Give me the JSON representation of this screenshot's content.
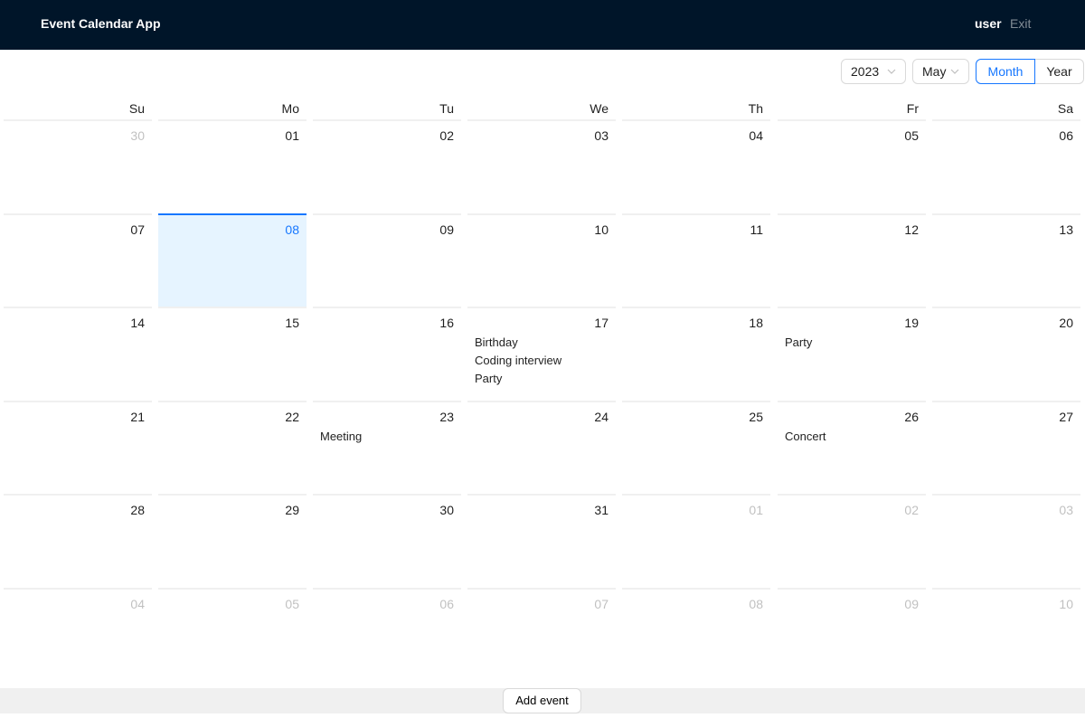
{
  "header": {
    "app_title": "Event Calendar App",
    "user": "user",
    "exit": "Exit"
  },
  "toolbar": {
    "year": "2023",
    "month": "May",
    "mode_month": "Month",
    "mode_year": "Year",
    "selected_mode": "Month"
  },
  "calendar": {
    "weekdays": [
      "Su",
      "Mo",
      "Tu",
      "We",
      "Th",
      "Fr",
      "Sa"
    ],
    "today": "08",
    "weeks": [
      [
        {
          "day": "30",
          "other": true,
          "events": []
        },
        {
          "day": "01",
          "other": false,
          "events": []
        },
        {
          "day": "02",
          "other": false,
          "events": []
        },
        {
          "day": "03",
          "other": false,
          "events": []
        },
        {
          "day": "04",
          "other": false,
          "events": []
        },
        {
          "day": "05",
          "other": false,
          "events": []
        },
        {
          "day": "06",
          "other": false,
          "events": []
        }
      ],
      [
        {
          "day": "07",
          "other": false,
          "events": []
        },
        {
          "day": "08",
          "other": false,
          "today": true,
          "events": []
        },
        {
          "day": "09",
          "other": false,
          "events": []
        },
        {
          "day": "10",
          "other": false,
          "events": []
        },
        {
          "day": "11",
          "other": false,
          "events": []
        },
        {
          "day": "12",
          "other": false,
          "events": []
        },
        {
          "day": "13",
          "other": false,
          "events": []
        }
      ],
      [
        {
          "day": "14",
          "other": false,
          "events": []
        },
        {
          "day": "15",
          "other": false,
          "events": []
        },
        {
          "day": "16",
          "other": false,
          "events": []
        },
        {
          "day": "17",
          "other": false,
          "events": [
            "Birthday",
            "Coding interview",
            "Party"
          ]
        },
        {
          "day": "18",
          "other": false,
          "events": []
        },
        {
          "day": "19",
          "other": false,
          "events": [
            "Party"
          ]
        },
        {
          "day": "20",
          "other": false,
          "events": []
        }
      ],
      [
        {
          "day": "21",
          "other": false,
          "events": []
        },
        {
          "day": "22",
          "other": false,
          "events": []
        },
        {
          "day": "23",
          "other": false,
          "events": [
            "Meeting"
          ]
        },
        {
          "day": "24",
          "other": false,
          "events": []
        },
        {
          "day": "25",
          "other": false,
          "events": []
        },
        {
          "day": "26",
          "other": false,
          "events": [
            "Concert"
          ]
        },
        {
          "day": "27",
          "other": false,
          "events": []
        }
      ],
      [
        {
          "day": "28",
          "other": false,
          "events": []
        },
        {
          "day": "29",
          "other": false,
          "events": []
        },
        {
          "day": "30",
          "other": false,
          "events": []
        },
        {
          "day": "31",
          "other": false,
          "events": []
        },
        {
          "day": "01",
          "other": true,
          "events": []
        },
        {
          "day": "02",
          "other": true,
          "events": []
        },
        {
          "day": "03",
          "other": true,
          "events": []
        }
      ],
      [
        {
          "day": "04",
          "other": true,
          "events": []
        },
        {
          "day": "05",
          "other": true,
          "events": []
        },
        {
          "day": "06",
          "other": true,
          "events": []
        },
        {
          "day": "07",
          "other": true,
          "events": []
        },
        {
          "day": "08",
          "other": true,
          "events": []
        },
        {
          "day": "09",
          "other": true,
          "events": []
        },
        {
          "day": "10",
          "other": true,
          "events": []
        }
      ]
    ]
  },
  "footer": {
    "add_event": "Add event"
  },
  "colors": {
    "header_bg": "#001529",
    "accent": "#1677ff",
    "today_bg": "#e6f4ff"
  },
  "icons": {
    "select_arrow": "chevron-down-icon"
  }
}
